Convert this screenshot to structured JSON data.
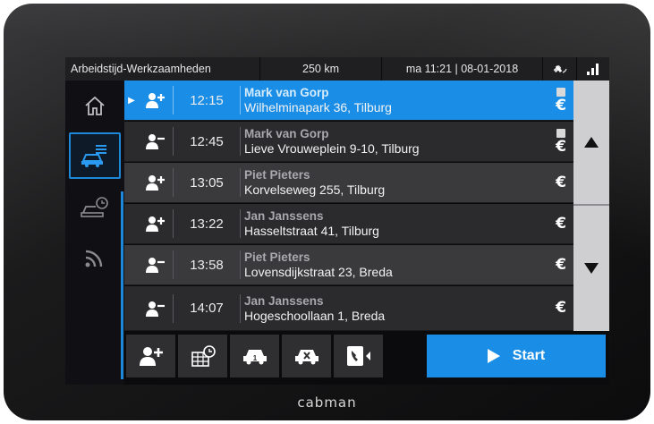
{
  "device": {
    "brand": "cabman"
  },
  "statusbar": {
    "title": "Arbeidstijd-Werkzaamheden",
    "distance": "250 km",
    "datetime": "ma 11:21 | 08-01-2018",
    "icons": [
      "satellite-icon",
      "signal-strength-icon"
    ]
  },
  "sidebar": {
    "items": [
      {
        "name": "home",
        "icon": "home-icon",
        "active": false
      },
      {
        "name": "trips",
        "icon": "taxi-list-icon",
        "active": true
      },
      {
        "name": "shift",
        "icon": "taxi-clock-icon",
        "active": false
      },
      {
        "name": "connection",
        "icon": "wifi-icon",
        "active": false
      }
    ]
  },
  "rides": [
    {
      "type": "pickup",
      "time": "12:15",
      "name": "Mark van Gorp",
      "address": "Wilhelminapark 36, Tilburg",
      "note": true,
      "payment": "€",
      "selected": true
    },
    {
      "type": "dropoff",
      "time": "12:45",
      "name": "Mark van Gorp",
      "address": "Lieve Vrouweplein 9-10, Tilburg",
      "note": true,
      "payment": "€",
      "selected": false
    },
    {
      "type": "pickup",
      "time": "13:05",
      "name": "Piet Pieters",
      "address": "Korvelseweg 255, Tilburg",
      "note": false,
      "payment": "€",
      "selected": false
    },
    {
      "type": "pickup",
      "time": "13:22",
      "name": "Jan Janssens",
      "address": "Hasseltstraat 41, Tilburg",
      "note": false,
      "payment": "€",
      "selected": false
    },
    {
      "type": "dropoff",
      "time": "13:58",
      "name": "Piet Pieters",
      "address": "Lovensdijkstraat 23, Breda",
      "note": false,
      "payment": "€",
      "selected": false
    },
    {
      "type": "dropoff",
      "time": "14:07",
      "name": "Jan Janssens",
      "address": "Hogeschoollaan 1, Breda",
      "note": false,
      "payment": "€",
      "selected": false
    }
  ],
  "toolbar": {
    "buttons": [
      "add-passenger-icon",
      "calendar-clock-icon",
      "taxi-pickup-icon",
      "taxi-cancel-icon",
      "call-icon"
    ],
    "start_label": "Start"
  },
  "colors": {
    "accent": "#1a8ee6",
    "row": "#3a3a3d",
    "row_alt": "#2b2b2e",
    "background": "#0b0b0d"
  }
}
